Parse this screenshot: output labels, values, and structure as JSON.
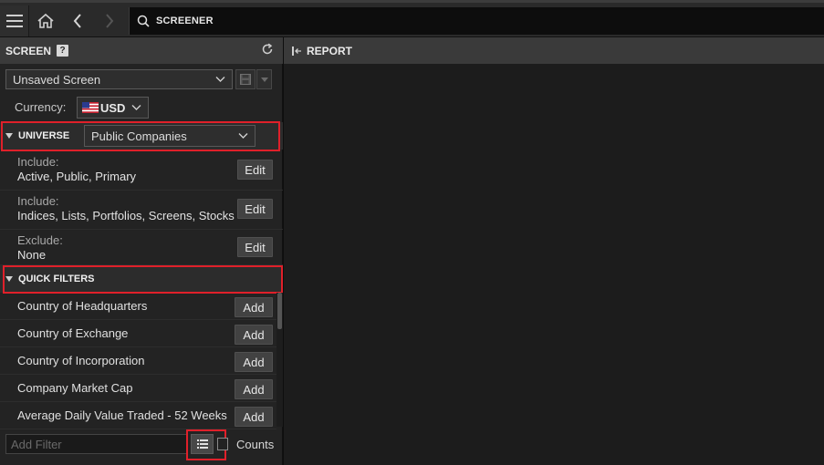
{
  "topbar": {
    "menu_icon": "hamburger-menu-icon",
    "home_icon": "home-icon",
    "back_icon": "chevron-left-icon",
    "forward_icon": "chevron-right-icon",
    "search_icon": "search-icon",
    "search_value": "SCREENER"
  },
  "screen_panel": {
    "title": "SCREEN",
    "help_label": "?",
    "refresh_icon": "refresh-icon",
    "screen_select": {
      "value": "Unsaved Screen"
    },
    "save_icon": "save-icon",
    "currency": {
      "label": "Currency:",
      "value": "USD",
      "flag_icon": "us-flag-icon"
    },
    "universe": {
      "label": "UNIVERSE",
      "select_value": "Public Companies",
      "rows": [
        {
          "label": "Include:",
          "value": "Active, Public, Primary",
          "button": "Edit"
        },
        {
          "label": "Include:",
          "value": "Indices, Lists, Portfolios, Screens, Stocks",
          "button": "Edit"
        },
        {
          "label": "Exclude:",
          "value": "None",
          "button": "Edit"
        }
      ]
    },
    "quick_filters": {
      "label": "QUICK FILTERS",
      "items": [
        {
          "name": "Country of Headquarters",
          "button": "Add"
        },
        {
          "name": "Country of Exchange",
          "button": "Add"
        },
        {
          "name": "Country of Incorporation",
          "button": "Add"
        },
        {
          "name": "Company Market Cap",
          "button": "Add"
        },
        {
          "name": "Average Daily Value Traded - 52 Weeks",
          "button": "Add"
        }
      ]
    },
    "add_filter": {
      "placeholder": "Add Filter",
      "list_icon": "list-icon"
    },
    "counts_label": "Counts"
  },
  "report_panel": {
    "title": "REPORT",
    "collapse_icon": "collapse-left-icon"
  },
  "colors": {
    "highlight": "#e0202a",
    "header_bg": "#3a3a3a",
    "panel_bg": "#232323"
  }
}
